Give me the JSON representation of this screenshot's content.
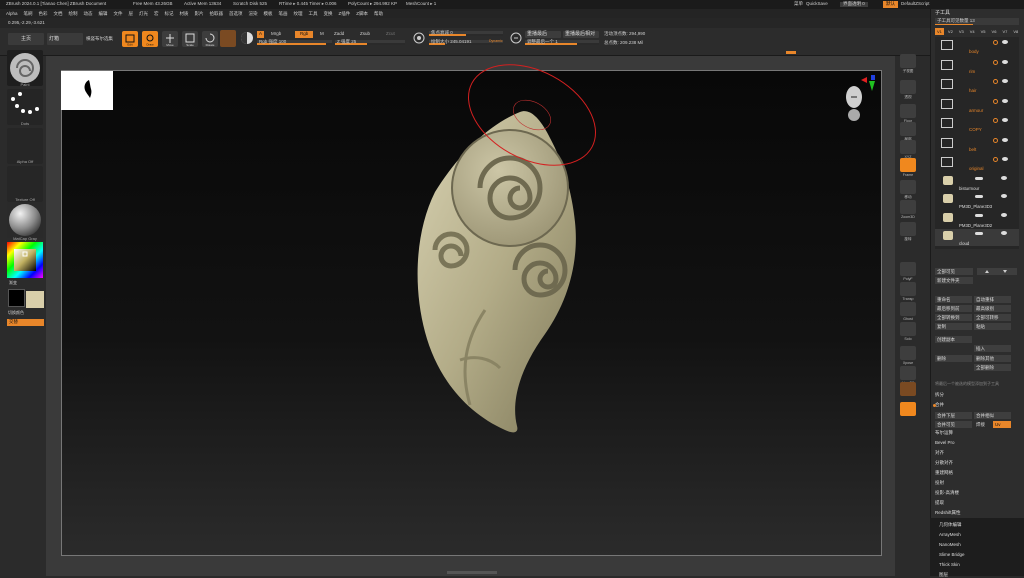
{
  "titlebar": {
    "app": "ZBrush 2024.0.1 [Tianao Chen]   ZBrush Document",
    "free_mem": "Free Mem 43.26GB",
    "active_mem": "Active Mem 13634",
    "scratch": "Scratch Disk 525",
    "rtime": "RTime ▸ 0.445 Timer ▸ 0.006",
    "polycount": "PolyCount ▸ 294.992 KP",
    "meshcount": "MeshCount ▸ 1",
    "right_items": [
      "菜单",
      "QuickSave",
      "界面透明 0"
    ],
    "default_label": "默认",
    "default_script": "DefaultZScript"
  },
  "menubar": {
    "items": [
      "Alpha",
      "笔刷",
      "色彩",
      "文档",
      "绘制",
      "动态",
      "编辑",
      "文件",
      "层",
      "灯光",
      "宏",
      "标记",
      "材质",
      "影片",
      "拾取器",
      "首选项",
      "渲染",
      "模板",
      "笔画",
      "纹理",
      "工具",
      "变换",
      "Z插件",
      "Z脚本",
      "帮助"
    ]
  },
  "coords": "0.295,-2.29,-3.621",
  "shelf": {
    "tab_light": "主页",
    "tab_lightbox": "灯箱",
    "tab_macro": "横竖布尔选集",
    "tools": [
      {
        "name": "edit-mode",
        "label": "Edit",
        "active": true
      },
      {
        "name": "draw-mode",
        "label": "Draw",
        "active": true
      },
      {
        "name": "move-mode",
        "label": "Move",
        "active": false
      },
      {
        "name": "scale-mode",
        "label": "Scale",
        "active": false
      },
      {
        "name": "rotate-mode",
        "label": "Rotate",
        "active": false
      }
    ],
    "a_label": "A",
    "mrgb": "Mrgb",
    "rgb": "Rgb",
    "m": "M",
    "zadd": "Zadd",
    "zsub": "Zsub",
    "zcut": "Zcut",
    "rgb_intensity": "Rgb 强度 100",
    "z_intensity": "Z 强度 25",
    "focal_shift": "焦点衰减 0",
    "draw_size": "绘制大小 245.04191",
    "dynamic": "Dynamic",
    "last_used": "重播最后",
    "last_relative": "重播最后相对",
    "adjust_last": "调整最后一个 1",
    "active_points": "活动顶点数: 294,990",
    "total_points": "总点数: 209.238 Mil"
  },
  "left": {
    "brush_label": "Paint",
    "stroke_label": "Dots",
    "alpha_label": "Alpha Off",
    "texture_label": "Texture Off",
    "material_label": "MatCap Gray",
    "gradient_label": "渐变",
    "switch_color": "切换颜色",
    "alternate": "交替",
    "secondary_color": "#d9cfaa",
    "primary_color": "#000000"
  },
  "rightshelf": {
    "items": [
      "子视图",
      "透视",
      "Floor",
      "局部",
      "XYZ",
      "Frame",
      "移动",
      "Zoom3D",
      "旋转",
      "PolyF",
      "Transp",
      "Ghost",
      "Solo",
      "Xpose",
      "Line Fill"
    ]
  },
  "tray": {
    "title": "子工具",
    "visible_count": "子工具可见数量 13",
    "tabs": [
      "V1",
      "V2",
      "V3",
      "V4",
      "V5",
      "V6",
      "V7",
      "V8"
    ],
    "subtools": [
      {
        "name": "body",
        "type": "folder"
      },
      {
        "name": "rim",
        "type": "folder"
      },
      {
        "name": "hair",
        "type": "folder"
      },
      {
        "name": "armour",
        "type": "folder"
      },
      {
        "name": "COPY",
        "type": "folder"
      },
      {
        "name": "belt",
        "type": "folder"
      },
      {
        "name": "original",
        "type": "folder"
      },
      {
        "name": "bisturmour",
        "type": "mesh"
      },
      {
        "name": "PM3D_Plane3D3",
        "type": "mesh"
      },
      {
        "name": "PM3D_Plane3D2",
        "type": "mesh"
      },
      {
        "name": "cloud",
        "type": "mesh"
      }
    ],
    "buttons_top": [
      "全部可见",
      "新建文件夹"
    ],
    "actions": [
      [
        "重命名",
        "自动重排"
      ],
      [
        "最后移到前",
        "最高级别"
      ],
      [
        "全部转换到",
        "全部可转移"
      ],
      [
        "复制",
        "粘贴"
      ],
      [
        "创建副本",
        "",
        "",
        "插入"
      ],
      [
        "删除",
        "删除其他",
        "",
        "全部删除"
      ]
    ],
    "hint": "将最后一个被选的模型添加到子工具",
    "sections": [
      "拆分",
      "合并",
      "合并下层",
      "合并可见",
      "布尔运算",
      "Bevel Pro",
      "对齐",
      "分散对齐",
      "重建网格",
      "投射",
      "投影-高清楼",
      "提取",
      "Redshift属性"
    ],
    "merge_down_btn": "合并下层",
    "merge_visible_btn": "合并可见",
    "merge_btn": "合并相似",
    "weld": "焊接",
    "uv": "Uv",
    "section2": [
      "几何体编辑",
      "ArrayMesh",
      "NanoMesh",
      "Slime Bridge",
      "Thick Skin",
      "图层"
    ]
  }
}
